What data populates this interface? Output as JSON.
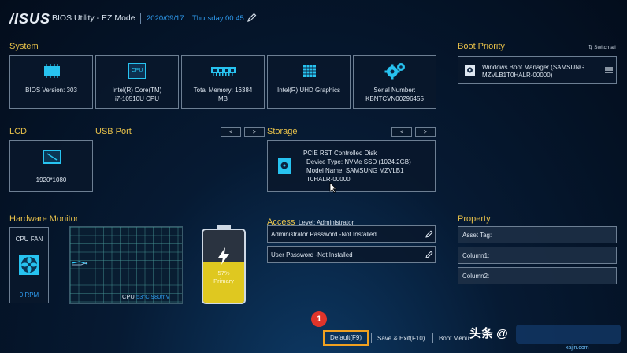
{
  "header": {
    "logo": "/ISUS",
    "title": "BIOS Utility - EZ Mode",
    "date": "2020/09/17",
    "day": "Thursday",
    "time": "00:45"
  },
  "system": {
    "title": "System",
    "cards": [
      {
        "lines": [
          "BIOS Version: 303"
        ],
        "icon": "chip-icon"
      },
      {
        "lines": [
          "Intel(R) Core(TM)",
          "i7-10510U CPU"
        ],
        "icon": "cpu-icon",
        "icon_text": "CPU"
      },
      {
        "lines": [
          "Total Memory: 16384",
          "MB"
        ],
        "icon": "memory-icon"
      },
      {
        "lines": [
          "Intel(R) UHD Graphics"
        ],
        "icon": "graphics-icon"
      },
      {
        "lines": [
          "Serial Number:",
          "KBNTCVN00296455"
        ],
        "icon": "gears-icon"
      }
    ]
  },
  "boot_priority": {
    "title": "Boot Priority",
    "switch_all": "Switch all",
    "items": [
      {
        "lines": [
          "Windows Boot Manager (SAMSUNG",
          "MZVLB1T0HALR-00000)"
        ]
      }
    ]
  },
  "lcd": {
    "title": "LCD",
    "value": "1920*1080"
  },
  "usb": {
    "title": "USB Port",
    "prev": "<",
    "next": ">"
  },
  "storage": {
    "title": "Storage",
    "prev": "<",
    "next": ">",
    "lines": [
      "PCIE RST Controlled Disk",
      "Device Type:  NVMe SSD  (1024.2GB)",
      "Model Name:   SAMSUNG MZVLB1",
      "T0HALR-00000"
    ]
  },
  "hardware_monitor": {
    "title": "Hardware Monitor",
    "fan_label": "CPU FAN",
    "fan_value": "0 RPM",
    "cpu_label": "CPU",
    "cpu_temp": "53°C",
    "cpu_voltage": "980mV",
    "battery_percent": "57%",
    "battery_label": "Primary",
    "battery_level": 0.57
  },
  "access": {
    "title": "Access",
    "level": "Level: Administrator",
    "admin_password": "Administrator Password -Not Installed",
    "user_password": "User Password -Not Installed"
  },
  "property": {
    "title": "Property",
    "fields": [
      "Asset Tag:",
      "Column1:",
      "Column2:"
    ]
  },
  "footer": {
    "badge": "1",
    "default": "Default(F9)",
    "save_exit": "Save & Exit(F10)",
    "boot_menu": "Boot Menu",
    "watermark": "头条 @",
    "watermark2": "xajjn.com"
  },
  "colors": {
    "accent_yellow": "#e9c24a",
    "accent_blue": "#2f9cf0",
    "highlight_orange": "#f0a020",
    "badge_red": "#e0342a"
  }
}
